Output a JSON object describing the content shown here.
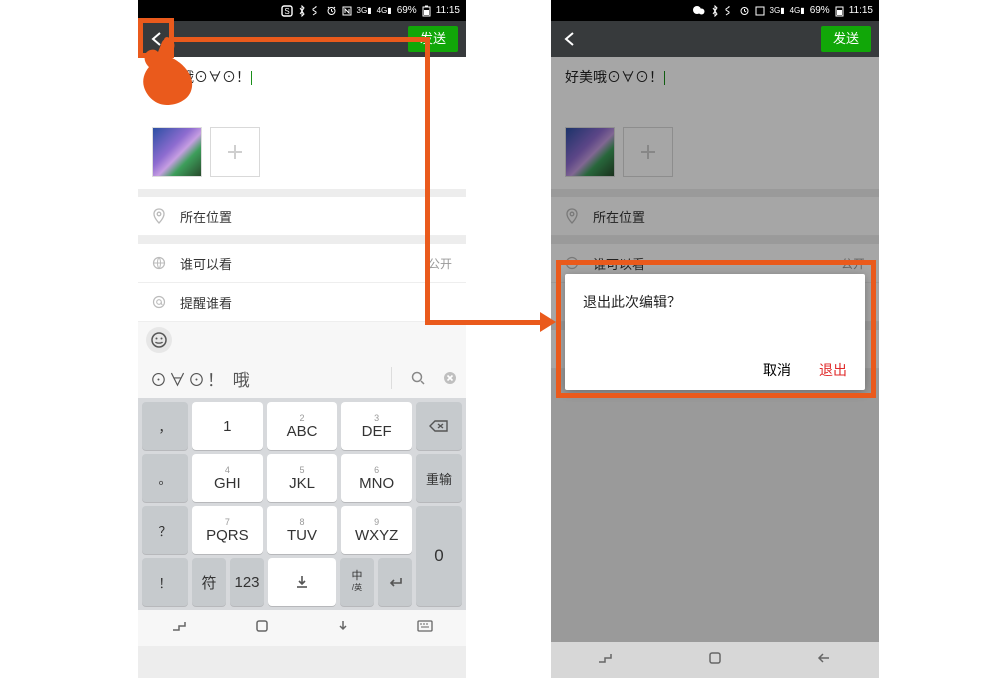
{
  "status": {
    "battery": "69%",
    "time": "11:15"
  },
  "appbar": {
    "send": "发送"
  },
  "compose": {
    "text": "好美哦⊙∀⊙！"
  },
  "list": {
    "location": "所在位置",
    "visibility": "谁可以看",
    "visibility_value": "公开",
    "mention": "提醒谁看"
  },
  "keyboard": {
    "candidate": "⊙∀⊙！ 哦",
    "keys": {
      "r1": [
        "1",
        "ABC",
        "DEF"
      ],
      "r1sup": [
        "",
        "2",
        "3"
      ],
      "r2": [
        "GHI",
        "JKL",
        "MNO"
      ],
      "r2sup": [
        "4",
        "5",
        "6"
      ],
      "r3": [
        "PQRS",
        "TUV",
        "WXYZ"
      ],
      "r3sup": [
        "7",
        "8",
        "9"
      ],
      "left": [
        "，",
        "。",
        "？",
        "！"
      ],
      "reinput": "重输",
      "zero": "0",
      "sym": "符",
      "num": "123",
      "lang1": "中",
      "lang2": "英"
    }
  },
  "dialog": {
    "title": "退出此次编辑？",
    "cancel": "取消",
    "exit": "退出"
  }
}
